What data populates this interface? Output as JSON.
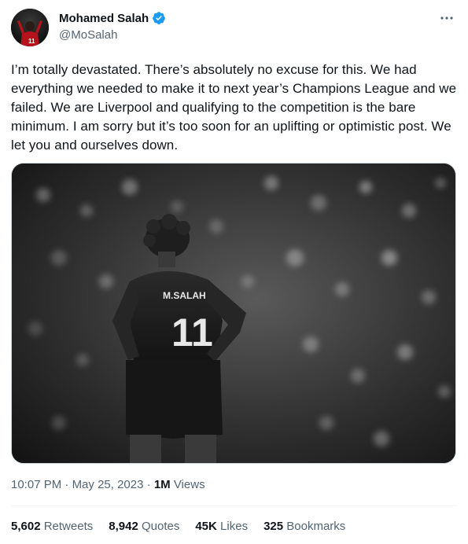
{
  "author": {
    "name": "Mohamed Salah",
    "handle": "@MoSalah",
    "verified": true
  },
  "post": {
    "text": "I’m totally devastated. There’s absolutely no excuse for this. We had everything we needed to make it to next year’s Champions League and we failed. We are Liverpool and qualifying to the competition is the bare minimum. I am sorry but it’s too soon for an uplifting or optimistic post. We let you and ourselves down.",
    "image": {
      "jersey_name": "M.SALAH",
      "jersey_number": "11"
    }
  },
  "meta": {
    "time": "10:07 PM",
    "separator": "·",
    "date": "May 25, 2023",
    "views_count": "1M",
    "views_label": "Views"
  },
  "stats": {
    "retweets_count": "5,602",
    "retweets_label": "Retweets",
    "quotes_count": "8,942",
    "quotes_label": "Quotes",
    "likes_count": "45K",
    "likes_label": "Likes",
    "bookmarks_count": "325",
    "bookmarks_label": "Bookmarks"
  },
  "colors": {
    "verified_blue": "#1d9bf0",
    "secondary_text": "#536471",
    "primary_text": "#0f1419"
  },
  "icons": {
    "verified": "verified-badge-icon",
    "more": "more-options-icon"
  }
}
